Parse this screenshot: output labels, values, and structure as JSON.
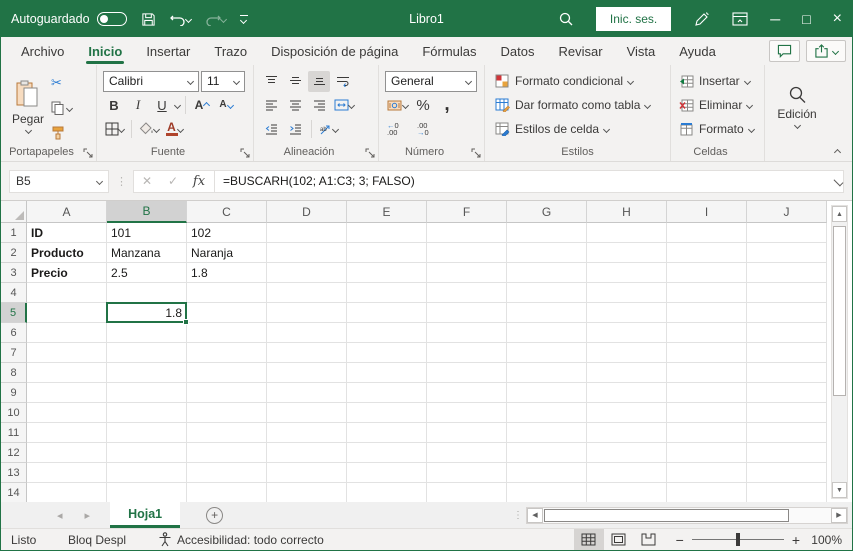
{
  "titlebar": {
    "autosave_label": "Autoguardado",
    "doc_title": "Libro1",
    "signin_label": "Inic. ses.",
    "bg_color": "#217346",
    "icons": [
      "autosave-toggle-off",
      "save-icon",
      "undo-icon",
      "redo-icon",
      "quick-access-chevron",
      "search-icon",
      "pen-icon",
      "ribbon-display-icon",
      "minimize-icon",
      "maximize-icon",
      "close-icon"
    ]
  },
  "ribbon_tabs": {
    "items": [
      "Archivo",
      "Inicio",
      "Insertar",
      "Trazo",
      "Disposición de página",
      "Fórmulas",
      "Datos",
      "Revisar",
      "Vista",
      "Ayuda"
    ],
    "active": "Inicio",
    "right_icons": [
      "comment-icon",
      "share-icon"
    ]
  },
  "ribbon": {
    "clipboard": {
      "label": "Portapapeles",
      "paste_label": "Pegar",
      "icons": [
        "paste-clipboard-icon",
        "cut-icon",
        "copy-icon",
        "format-painter-icon"
      ]
    },
    "font": {
      "label": "Fuente",
      "font_name": "Calibri",
      "font_size": "11",
      "bold": "B",
      "italic": "I",
      "underline": "U",
      "icons": [
        "grow-font-icon",
        "shrink-font-icon",
        "borders-icon",
        "fill-color-icon",
        "font-color-icon"
      ]
    },
    "alignment": {
      "label": "Alineación",
      "icons": [
        "align-top-icon",
        "align-middle-icon",
        "align-bottom-icon",
        "wrap-text-icon",
        "align-left-icon",
        "align-center-icon",
        "align-right-icon",
        "merge-center-icon",
        "decrease-indent-icon",
        "increase-indent-icon",
        "orientation-icon"
      ]
    },
    "number": {
      "label": "Número",
      "format": "General",
      "icons": [
        "accounting-format-icon",
        "percent-icon",
        "comma-icon",
        "increase-decimal-icon",
        "decrease-decimal-icon"
      ]
    },
    "styles": {
      "label": "Estilos",
      "buttons": [
        "Formato condicional",
        "Dar formato como tabla",
        "Estilos de celda"
      ],
      "icons": [
        "conditional-format-icon",
        "format-table-icon",
        "cell-styles-icon"
      ]
    },
    "cells": {
      "label": "Celdas",
      "buttons": [
        "Insertar",
        "Eliminar",
        "Formato"
      ],
      "icons": [
        "insert-cells-icon",
        "delete-cells-icon",
        "format-cells-icon"
      ]
    },
    "editing": {
      "label": "Edición",
      "icons": [
        "find-select-icon"
      ]
    }
  },
  "formula_bar": {
    "name_box": "B5",
    "fx_label": "fx",
    "formula": "=BUSCARH(102; A1:C3; 3; FALSO)"
  },
  "grid": {
    "columns": [
      "A",
      "B",
      "C",
      "D",
      "E",
      "F",
      "G",
      "H",
      "I",
      "J"
    ],
    "row_count": 14,
    "selected_column": "B",
    "selected_row": 5,
    "selected_cell": "B5",
    "cells": {
      "A1": {
        "text": "ID",
        "bold": true
      },
      "B1": {
        "text": "101"
      },
      "C1": {
        "text": "102"
      },
      "A2": {
        "text": "Producto",
        "bold": true
      },
      "B2": {
        "text": "Manzana"
      },
      "C2": {
        "text": "Naranja"
      },
      "A3": {
        "text": "Precio",
        "bold": true
      },
      "B3": {
        "text": "2.5"
      },
      "C3": {
        "text": "1.8"
      },
      "B5": {
        "text": "1.8",
        "align": "right"
      }
    }
  },
  "sheet_bar": {
    "sheet_name": "Hoja1",
    "icons": [
      "sheet-prev-icon",
      "sheet-next-icon",
      "add-sheet-icon"
    ]
  },
  "status_bar": {
    "mode": "Listo",
    "scroll_lock": "Bloq Despl",
    "accessibility": "Accesibilidad: todo correcto",
    "zoom_level": "100%",
    "icons": [
      "accessibility-icon",
      "view-normal-icon",
      "view-layout-icon",
      "view-pagebreak-icon",
      "zoom-out-icon",
      "zoom-in-icon"
    ]
  },
  "colors": {
    "accent": "#217346",
    "selection_border": "#217346",
    "selected_header_bg": "#d2d2d2",
    "grid_line": "#e2e2e2"
  }
}
